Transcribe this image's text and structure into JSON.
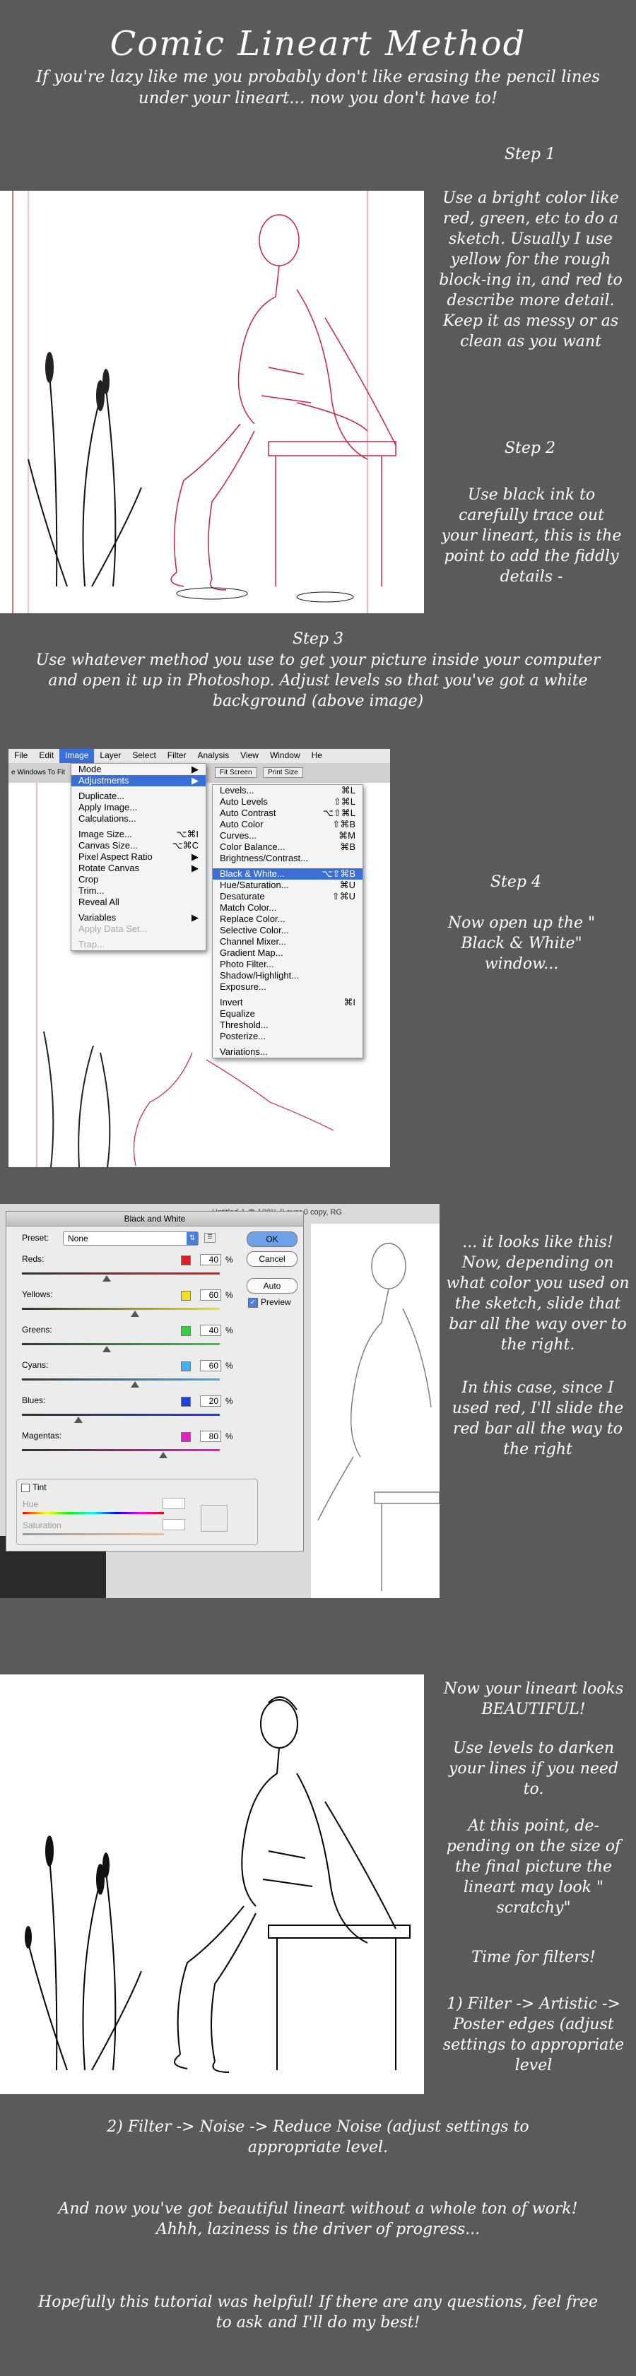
{
  "title": "Comic Lineart Method",
  "intro": "If you're lazy like me you probably don't like erasing the pencil lines under your lineart... now you don't have to!",
  "step1": {
    "heading": "Step 1",
    "text": "Use a bright color like red, green, etc to do a sketch. Usually I use yellow for the rough block-ing in, and red to describe more detail. Keep it as messy or as clean as you want"
  },
  "step2": {
    "heading": "Step 2",
    "text": "Use black ink to carefully trace out your lineart, this is the point to add the fiddly details -"
  },
  "step3": {
    "heading": "Step 3",
    "text": "Use whatever method you use to get your picture inside your computer and open it up in Photoshop. Adjust levels so that you've got a white background (above image)"
  },
  "step4": {
    "heading": "Step 4",
    "text": "Now open up the \" Black & White\" window..."
  },
  "ps": {
    "menubar": [
      "File",
      "Edit",
      "Image",
      "Layer",
      "Select",
      "Filter",
      "Analysis",
      "View",
      "Window",
      "He"
    ],
    "toolbar_left": "e Windows To Fit",
    "toolbar_btns": [
      "Fit Screen",
      "Print Size"
    ],
    "image_menu": [
      {
        "label": "Mode",
        "key": "▶"
      },
      {
        "label": "Adjustments",
        "key": "▶"
      },
      {
        "label": "Duplicate...",
        "key": ""
      },
      {
        "label": "Apply Image...",
        "key": ""
      },
      {
        "label": "Calculations...",
        "key": ""
      },
      {
        "label": "Image Size...",
        "key": "⌥⌘I"
      },
      {
        "label": "Canvas Size...",
        "key": "⌥⌘C"
      },
      {
        "label": "Pixel Aspect Ratio",
        "key": "▶"
      },
      {
        "label": "Rotate Canvas",
        "key": "▶"
      },
      {
        "label": "Crop",
        "key": ""
      },
      {
        "label": "Trim...",
        "key": ""
      },
      {
        "label": "Reveal All",
        "key": ""
      },
      {
        "label": "Variables",
        "key": "▶"
      },
      {
        "label": "Apply Data Set...",
        "key": ""
      },
      {
        "label": "Trap...",
        "key": ""
      }
    ],
    "adj_menu": [
      {
        "label": "Levels...",
        "key": "⌘L"
      },
      {
        "label": "Auto Levels",
        "key": "⇧⌘L"
      },
      {
        "label": "Auto Contrast",
        "key": "⌥⇧⌘L"
      },
      {
        "label": "Auto Color",
        "key": "⇧⌘B"
      },
      {
        "label": "Curves...",
        "key": "⌘M"
      },
      {
        "label": "Color Balance...",
        "key": "⌘B"
      },
      {
        "label": "Brightness/Contrast...",
        "key": ""
      },
      {
        "label": "Black & White...",
        "key": "⌥⇧⌘B"
      },
      {
        "label": "Hue/Saturation...",
        "key": "⌘U"
      },
      {
        "label": "Desaturate",
        "key": "⇧⌘U"
      },
      {
        "label": "Match Color...",
        "key": ""
      },
      {
        "label": "Replace Color...",
        "key": ""
      },
      {
        "label": "Selective Color...",
        "key": ""
      },
      {
        "label": "Channel Mixer...",
        "key": ""
      },
      {
        "label": "Gradient Map...",
        "key": ""
      },
      {
        "label": "Photo Filter...",
        "key": ""
      },
      {
        "label": "Shadow/Highlight...",
        "key": ""
      },
      {
        "label": "Exposure...",
        "key": ""
      },
      {
        "label": "Invert",
        "key": "⌘I"
      },
      {
        "label": "Equalize",
        "key": ""
      },
      {
        "label": "Threshold...",
        "key": ""
      },
      {
        "label": "Posterize...",
        "key": ""
      },
      {
        "label": "Variations...",
        "key": ""
      }
    ]
  },
  "bw": {
    "title": "Black and White",
    "doc_title": "Untitled-1 @ 100% (Layer 0 copy, RG",
    "preset_label": "Preset:",
    "preset_value": "None",
    "ok": "OK",
    "cancel": "Cancel",
    "auto": "Auto",
    "preview": "Preview",
    "rows": [
      {
        "label": "Reds:",
        "value": "40",
        "color": "#e02020",
        "level": 40
      },
      {
        "label": "Yellows:",
        "value": "60",
        "color": "#f0e020",
        "level": 60
      },
      {
        "label": "Greens:",
        "value": "40",
        "color": "#30d040",
        "level": 40
      },
      {
        "label": "Cyans:",
        "value": "60",
        "color": "#40b0f0",
        "level": 60
      },
      {
        "label": "Blues:",
        "value": "20",
        "color": "#2040e0",
        "level": 20
      },
      {
        "label": "Magentas:",
        "value": "80",
        "color": "#e020c0",
        "level": 80
      }
    ],
    "pct": "%",
    "tint": "Tint",
    "hue": "Hue",
    "saturation": "Saturation"
  },
  "step4b": {
    "text1": "... it looks like this! Now, depending on what color you used on the sketch, slide that bar all the way over to the right.",
    "text2": "In this case, since I used red, I'll slide the red bar all the way to the right"
  },
  "step5": {
    "text1": "Now your lineart looks BEAUTIFUL!",
    "text2": "Use levels to darken your lines if you need to.",
    "text3": "At this point, de-pending on the size of the final picture the lineart may look \" scratchy\"",
    "text4": "Time for filters!",
    "text5": "1) Filter -> Artistic -> Poster edges (adjust settings to appropriate level"
  },
  "filter2": "2) Filter -> Noise -> Reduce Noise (adjust settings to appropriate level.",
  "outro1": "And now you've got beautiful lineart without a whole ton of work! Ahhh, laziness is the driver of progress...",
  "outro2": "Hopefully this tutorial was helpful! If there are any questions, feel free to ask and I'll do my best!"
}
